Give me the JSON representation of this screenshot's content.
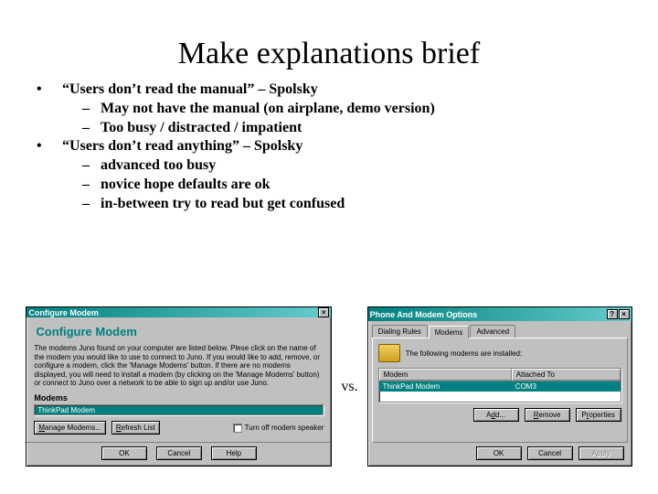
{
  "title": "Make explanations brief",
  "bullets": [
    {
      "level": 1,
      "text": "“Users don’t read the manual” – Spolsky"
    },
    {
      "level": 2,
      "text": "May not have the manual (on airplane, demo version)"
    },
    {
      "level": 2,
      "text": "Too busy / distracted / impatient"
    },
    {
      "level": 1,
      "text": "“Users don’t read anything” – Spolsky"
    },
    {
      "level": 2,
      "text": "advanced too busy"
    },
    {
      "level": 2,
      "text": "novice hope defaults are ok"
    },
    {
      "level": 2,
      "text": "in-between try to read but get confused"
    }
  ],
  "vs_label": "vs.",
  "dialog_left": {
    "title": "Configure Modem",
    "header": "Configure Modem",
    "body_text": "The modems Juno found on your computer are listed below. Plese click on the name of the modem you would like to use to connect to Juno. If you would like to add, remove, or configure a modem, click the 'Manage Modems' button. If there are no modems displayed, you will need to install a modem (by clicking on the 'Manage Modems' button) or connect to Juno over a network to be able to sign up and/or use Juno.",
    "modems_label": "Modems",
    "selected_modem": "ThinkPad Modem",
    "manage_btn": "Manage Modems...",
    "refresh_btn": "Refresh List",
    "speaker_chk": "Turn off modem speaker",
    "ok": "OK",
    "cancel": "Cancel",
    "help": "Help"
  },
  "dialog_right": {
    "title": "Phone And Modem Options",
    "tabs": [
      "Dialing Rules",
      "Modems",
      "Advanced"
    ],
    "active_tab": 1,
    "caption": "The following modems are installed:",
    "columns": [
      "Modem",
      "Attached To"
    ],
    "row": {
      "modem": "ThinkPad Modem",
      "port": "COM3"
    },
    "add_btn": "Add...",
    "remove_btn": "Remove",
    "props_btn": "Properties",
    "ok": "OK",
    "cancel": "Cancel",
    "apply": "Apply"
  }
}
